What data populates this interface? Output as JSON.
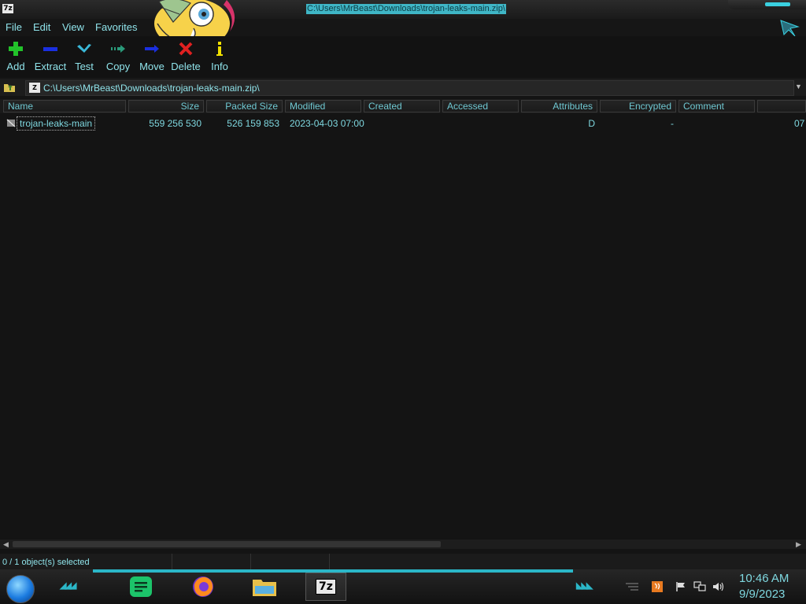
{
  "window": {
    "title": "C:\\Users\\MrBeast\\Downloads\\trojan-leaks-main.zip\\",
    "app_icon_text": "7z"
  },
  "menu": {
    "file": "File",
    "edit": "Edit",
    "view": "View",
    "favorites": "Favorites"
  },
  "toolbar": {
    "add": "Add",
    "extract": "Extract",
    "test": "Test",
    "copy": "Copy",
    "move": "Move",
    "delete": "Delete",
    "info": "Info"
  },
  "address": {
    "path": "C:\\Users\\MrBeast\\Downloads\\trojan-leaks-main.zip\\"
  },
  "columns": {
    "name": "Name",
    "size": "Size",
    "packed_size": "Packed Size",
    "modified": "Modified",
    "created": "Created",
    "accessed": "Accessed",
    "attributes": "Attributes",
    "encrypted": "Encrypted",
    "comment": "Comment"
  },
  "rows": [
    {
      "name": "trojan-leaks-main",
      "size": "559 256 530",
      "packed_size": "526 159 853",
      "modified": "2023-04-03 07:00",
      "created": "",
      "accessed": "",
      "attributes": "D",
      "encrypted": "-",
      "comment": "",
      "overflow": "07"
    }
  ],
  "status": {
    "selection": "0 / 1 object(s) selected"
  },
  "taskbar": {
    "sevenzip_label": "7z",
    "time": "10:46 AM",
    "date": "9/9/2023"
  },
  "colors": {
    "accent": "#2bb7c8",
    "text": "#7fd8e0",
    "background": "#141414",
    "title_highlight": "#3fb6c6"
  }
}
